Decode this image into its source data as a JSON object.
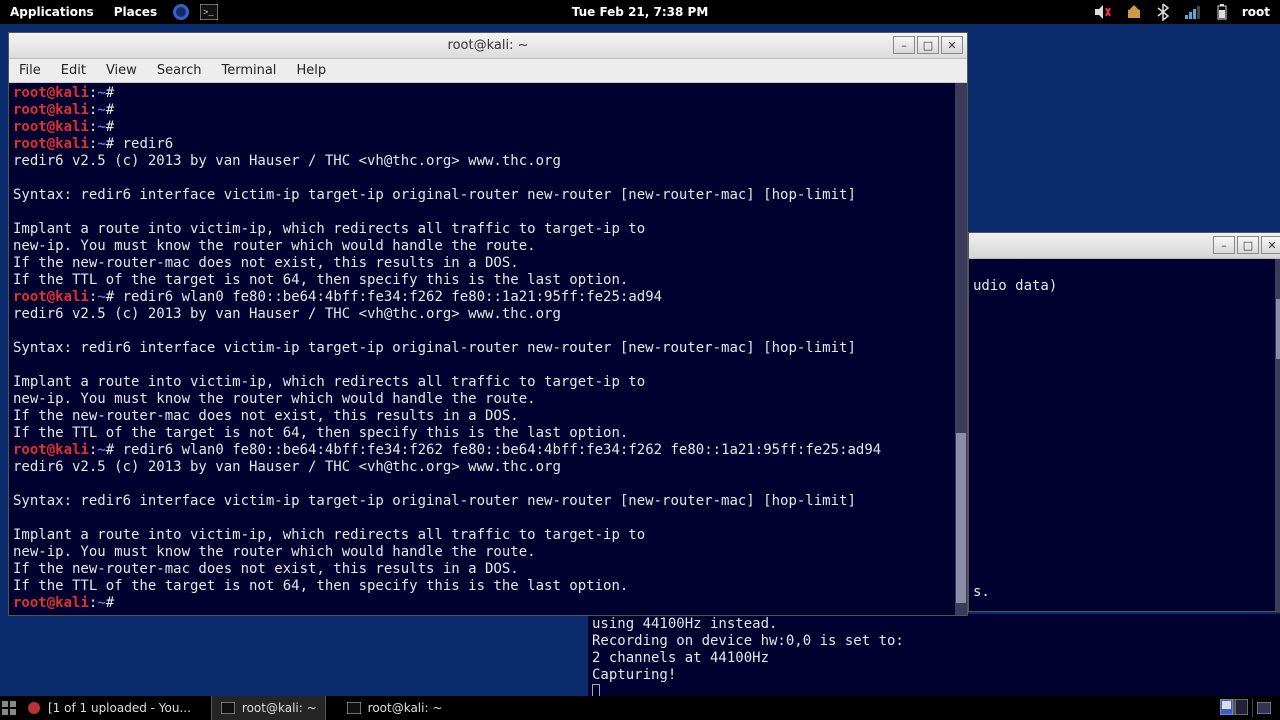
{
  "panel": {
    "applications": "Applications",
    "places": "Places",
    "clock": "Tue Feb 21,  7:38 PM",
    "tray_user": "root"
  },
  "bg_window": {
    "body_line": "udio data)",
    "extra1": "s.",
    "extra2": "..."
  },
  "terminal": {
    "title": "root@kali: ~",
    "menu": {
      "file": "File",
      "edit": "Edit",
      "view": "View",
      "search": "Search",
      "terminal": "Terminal",
      "help": "Help"
    },
    "prompt": {
      "user": "root",
      "at": "@",
      "host": "kali",
      "sep": ":",
      "path": "~",
      "tail": "#"
    },
    "cmd1": "redir6",
    "cmd2": "redir6 wlan0 fe80::be64:4bff:fe34:f262 fe80::1a21:95ff:fe25:ad94",
    "cmd3": "redir6 wlan0 fe80::be64:4bff:fe34:f262 fe80::be64:4bff:fe34:f262 fe80::1a21:95ff:fe25:ad94",
    "out": {
      "ver": "redir6 v2.5 (c) 2013 by van Hauser / THC <vh@thc.org> www.thc.org",
      "syn": "Syntax: redir6 interface victim-ip target-ip original-router new-router [new-router-mac] [hop-limit]",
      "d1": "Implant a route into victim-ip, which redirects all traffic to target-ip to",
      "d2": "new-ip. You must know the router which would handle the route.",
      "d3": "If the new-router-mac does not exist, this results in a DOS.",
      "d4": "If the TTL of the target is not 64, then specify this is the last option."
    }
  },
  "lower": {
    "l0": "using 44100Hz instead.",
    "l1": "Recording on device hw:0,0 is set to:",
    "l2": "2 channels at 44100Hz",
    "l3": "Capturing!"
  },
  "taskbar": {
    "t1": "[1 of 1 uploaded - You...",
    "t2": "root@kali: ~",
    "t3": "root@kali: ~"
  }
}
